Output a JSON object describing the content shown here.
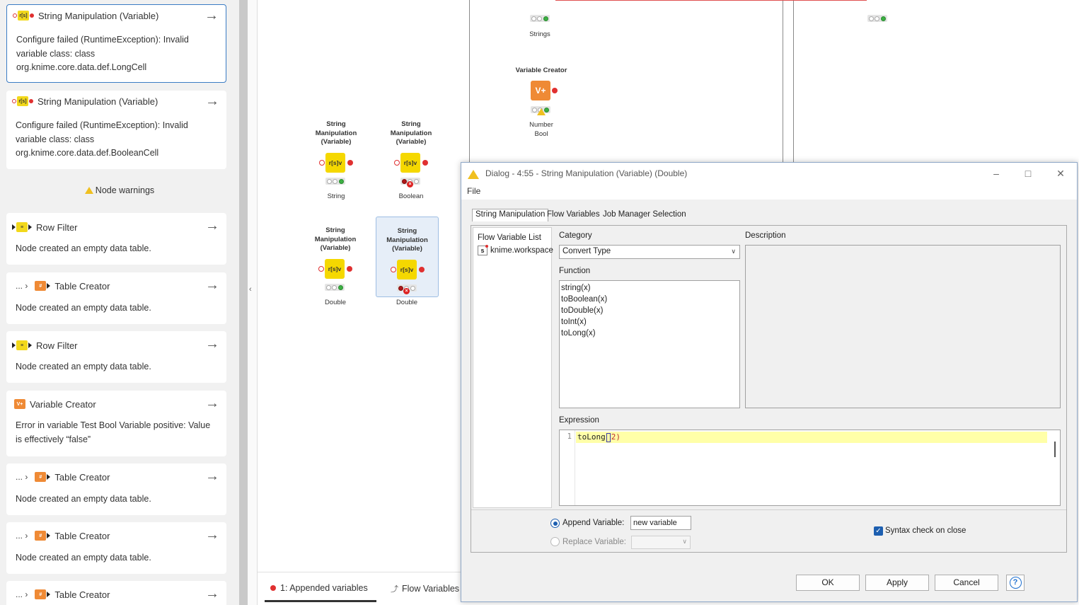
{
  "sidebar": {
    "cards": [
      {
        "title": "String Manipulation (Variable)",
        "message": [
          "Configure failed (RuntimeException): Invalid",
          "variable class: class",
          "org.knime.core.data.def.LongCell"
        ],
        "icon": "string-manipulation-variable-icon"
      },
      {
        "title": "String Manipulation (Variable)",
        "message": [
          "Configure failed (RuntimeException): Invalid",
          "variable class: class",
          "org.knime.core.data.def.BooleanCell"
        ],
        "icon": "string-manipulation-variable-icon"
      },
      {
        "title": "Row Filter",
        "message": [
          "Node created an empty data table."
        ],
        "icon": "row-filter-icon"
      },
      {
        "title": "Table Creator",
        "crumb": "...",
        "message": [
          "Node created an empty data table."
        ],
        "icon": "table-creator-icon"
      },
      {
        "title": "Row Filter",
        "message": [
          "Node created an empty data table."
        ],
        "icon": "row-filter-icon"
      },
      {
        "title": "Variable Creator",
        "message": [
          "Error in variable Test Bool Variable positive: Value",
          "is effectively “false”"
        ],
        "icon": "variable-creator-icon"
      },
      {
        "title": "Table Creator",
        "crumb": "...",
        "message": [
          "Node created an empty data table."
        ],
        "icon": "table-creator-icon"
      },
      {
        "title": "Table Creator",
        "crumb": "...",
        "message": [
          "Node created an empty data table."
        ],
        "icon": "table-creator-icon"
      },
      {
        "title": "Table Creator",
        "crumb": "...",
        "message": [],
        "icon": "table-creator-icon"
      }
    ],
    "section_warnings": "Node warnings",
    "arrow": "→",
    "chevron": "›"
  },
  "canvas": {
    "nodes": [
      {
        "title": [
          "String",
          "Manipulation",
          "(Variable)"
        ],
        "label": [
          "String"
        ],
        "status": "green"
      },
      {
        "title": [
          "String",
          "Manipulation",
          "(Variable)"
        ],
        "label": [
          "Boolean"
        ],
        "status": "error"
      },
      {
        "title": [
          "String",
          "Manipulation",
          "(Variable)"
        ],
        "label": [
          "Double"
        ],
        "status": "green"
      },
      {
        "title": [
          "String",
          "Manipulation",
          "(Variable)"
        ],
        "label": [
          "Double"
        ],
        "status": "error"
      },
      {
        "title": [
          "Variable Creator"
        ],
        "label": [
          "Number",
          "Bool"
        ],
        "status": "warning"
      }
    ],
    "top_node_label": "Strings",
    "node_icon_text": "r[s]v",
    "vc_icon_text": "V+"
  },
  "bottom_tabs": {
    "appended": "1: Appended variables",
    "flow": "Flow Variables"
  },
  "dialog": {
    "title": "Dialog - 4:55 - String Manipulation (Variable) (Double)",
    "menu_file": "File",
    "tabs": [
      "String Manipulation",
      "Flow Variables",
      "Job Manager Selection"
    ],
    "flow_variable_list_label": "Flow Variable List",
    "flow_variable_item": "knime.workspace",
    "category_label": "Category",
    "category_value": "Convert Type",
    "function_label": "Function",
    "functions": [
      "string(x)",
      "toBoolean(x)",
      "toDouble(x)",
      "toInt(x)",
      "toLong(x)"
    ],
    "description_label": "Description",
    "expression_label": "Expression",
    "expression_line_no": "1",
    "expression_fn": "toLong",
    "expression_open": "(",
    "expression_arg": "2",
    "expression_close": ")",
    "append_label": "Append Variable:",
    "append_value": "new variable",
    "replace_label": "Replace Variable:",
    "syntax_check_label": "Syntax check on close",
    "ok": "OK",
    "apply": "Apply",
    "cancel": "Cancel",
    "help": "?",
    "win_min": "–",
    "win_max": "□",
    "win_close": "✕"
  },
  "colors": {
    "accent": "#1d5fb0",
    "error": "#e03030",
    "node_yellow": "#f5d800",
    "node_orange": "#ef8a35",
    "selected_border": "#3b7cc4"
  }
}
